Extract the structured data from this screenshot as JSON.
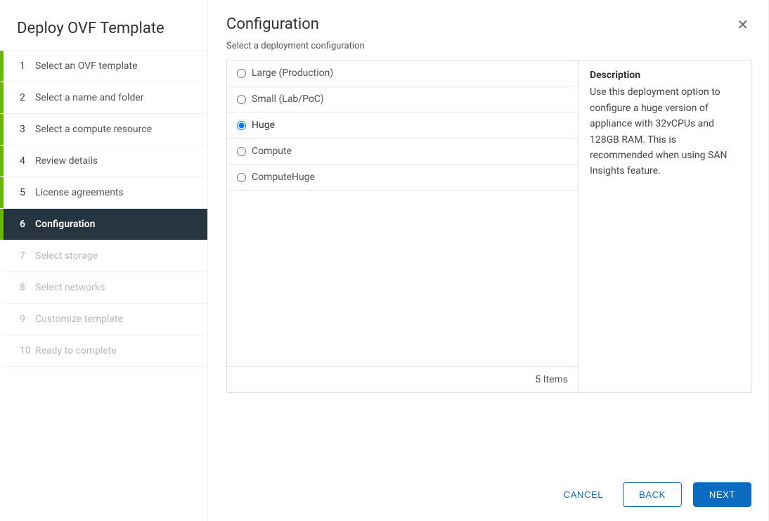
{
  "wizard_title": "Deploy OVF Template",
  "steps": [
    {
      "num": "1",
      "label": "Select an OVF template",
      "state": "completed"
    },
    {
      "num": "2",
      "label": "Select a name and folder",
      "state": "completed"
    },
    {
      "num": "3",
      "label": "Select a compute resource",
      "state": "completed"
    },
    {
      "num": "4",
      "label": "Review details",
      "state": "completed"
    },
    {
      "num": "5",
      "label": "License agreements",
      "state": "completed"
    },
    {
      "num": "6",
      "label": "Configuration",
      "state": "active"
    },
    {
      "num": "7",
      "label": "Select storage",
      "state": "disabled"
    },
    {
      "num": "8",
      "label": "Select networks",
      "state": "disabled"
    },
    {
      "num": "9",
      "label": "Customize template",
      "state": "disabled"
    },
    {
      "num": "10",
      "label": "Ready to complete",
      "state": "disabled"
    }
  ],
  "page": {
    "title": "Configuration",
    "subtitle": "Select a deployment configuration"
  },
  "options": [
    {
      "label": "Large (Production)",
      "selected": false
    },
    {
      "label": "Small (Lab/PoC)",
      "selected": false
    },
    {
      "label": "Huge",
      "selected": true
    },
    {
      "label": "Compute",
      "selected": false
    },
    {
      "label": "ComputeHuge",
      "selected": false
    }
  ],
  "items_footer": "5 Items",
  "description": {
    "heading": "Description",
    "text": "Use this deployment option to configure a huge version of appliance with 32vCPUs and 128GB RAM. This is recommended when using SAN Insights feature."
  },
  "buttons": {
    "cancel": "CANCEL",
    "back": "BACK",
    "next": "NEXT"
  }
}
